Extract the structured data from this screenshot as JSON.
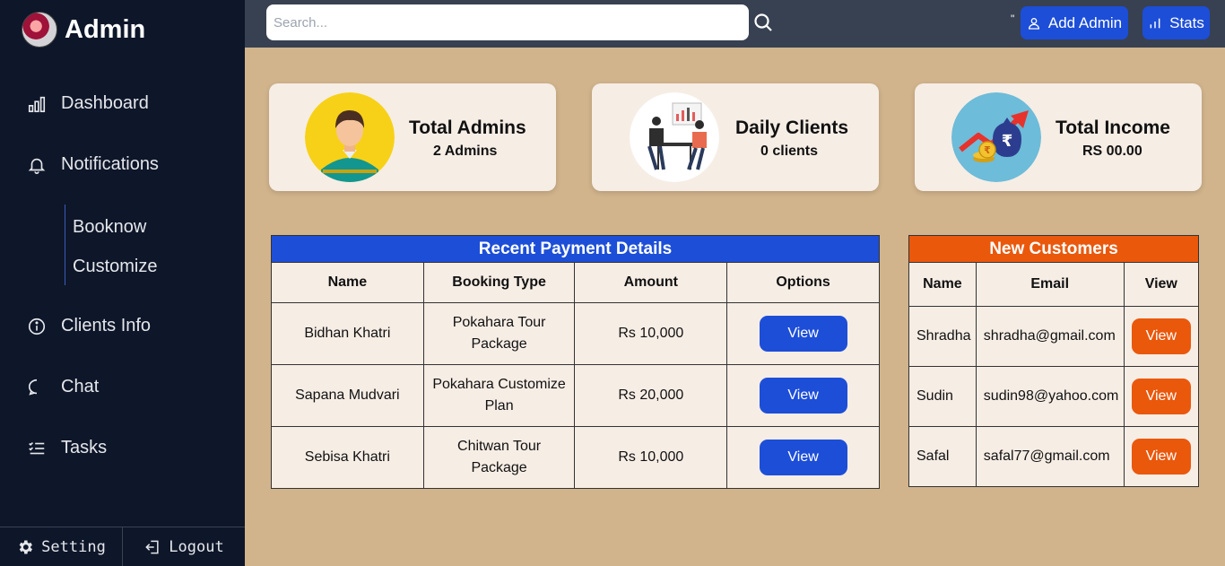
{
  "brand": {
    "title": "Admin"
  },
  "sidebar": {
    "items": [
      {
        "label": "Dashboard",
        "icon": "bar-chart-icon"
      },
      {
        "label": "Notifications",
        "icon": "bell-icon"
      },
      {
        "label": "Clients Info",
        "icon": "info-icon"
      },
      {
        "label": "Chat",
        "icon": "chat-icon"
      },
      {
        "label": "Tasks",
        "icon": "tasks-icon"
      }
    ],
    "subitems": [
      "Booknow",
      "Customize"
    ],
    "footer": {
      "setting": "Setting",
      "logout": "Logout"
    }
  },
  "topbar": {
    "search_placeholder": "Search...",
    "quote": "\"",
    "add_admin": "Add Admin",
    "stats": "Stats"
  },
  "cards": [
    {
      "title": "Total Admins",
      "value": "2 Admins"
    },
    {
      "title": "Daily Clients",
      "value": "0 clients"
    },
    {
      "title": "Total Income",
      "value": "RS 00.00"
    }
  ],
  "payments": {
    "title": "Recent Payment Details",
    "headers": [
      "Name",
      "Booking Type",
      "Amount",
      "Options"
    ],
    "rows": [
      {
        "name": "Bidhan Khatri",
        "type_line1": "Pokahara Tour",
        "type_line2": "Package",
        "amount": "Rs 10,000",
        "action": "View"
      },
      {
        "name": "Sapana Mudvari",
        "type_line1": "Pokahara Customize",
        "type_line2": "Plan",
        "amount": "Rs 20,000",
        "action": "View"
      },
      {
        "name": "Sebisa Khatri",
        "type_line1": "Chitwan Tour",
        "type_line2": "Package",
        "amount": "Rs 10,000",
        "action": "View"
      }
    ]
  },
  "customers": {
    "title": "New Customers",
    "headers": [
      "Name",
      "Email",
      "View"
    ],
    "rows": [
      {
        "name": "Shradha",
        "email": "shradha@gmail.com",
        "action": "View"
      },
      {
        "name": "Sudin",
        "email": "sudin98@yahoo.com",
        "action": "View"
      },
      {
        "name": "Safal",
        "email": "safal77@gmail.com",
        "action": "View"
      }
    ]
  },
  "colors": {
    "sidebar_bg": "#0e1629",
    "topbar_bg": "#374151",
    "page_bg": "#d1b48c",
    "card_bg": "#f6ede5",
    "primary_blue": "#1d4ed8",
    "accent_orange": "#ea580c"
  }
}
